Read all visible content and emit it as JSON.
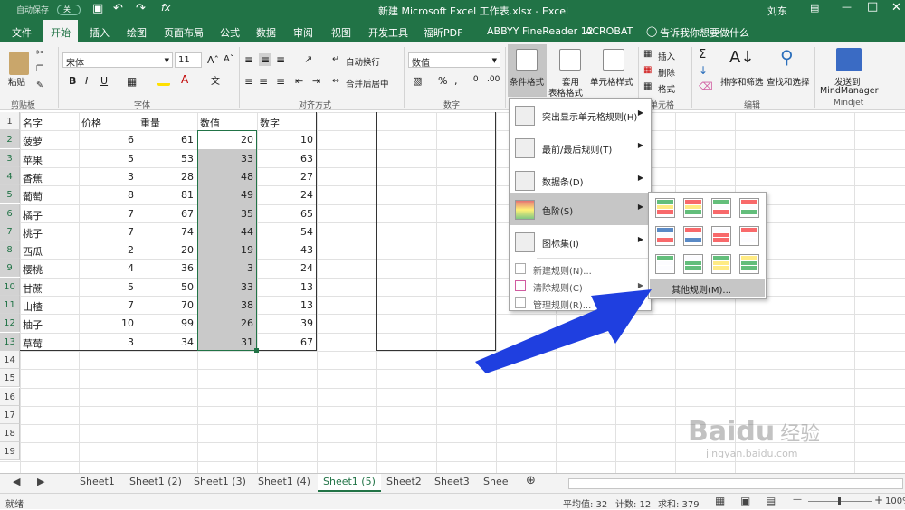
{
  "titlebar": {
    "autosave": "自动保存",
    "autosave_state": "关",
    "title": "新建 Microsoft Excel 工作表.xlsx  -  Excel",
    "user": "刘东"
  },
  "tabs": [
    "文件",
    "开始",
    "插入",
    "绘图",
    "页面布局",
    "公式",
    "数据",
    "审阅",
    "视图",
    "开发工具",
    "福昕PDF",
    "ABBYY FineReader 12",
    "ACROBAT"
  ],
  "tellme": "告诉我你想要做什么",
  "ribbon": {
    "paste": "粘贴",
    "clipboard": "剪贴板",
    "font_name": "宋体",
    "font_size": "11",
    "font_group": "字体",
    "wrap": "自动换行",
    "merge": "合并后居中",
    "align_group": "对齐方式",
    "number_format": "数值",
    "number_group": "数字",
    "cond_format": "条件格式",
    "table_format_1": "套用",
    "table_format_2": "表格格式",
    "cell_style": "单元格样式",
    "insert": "插入",
    "delete": "删除",
    "format": "格式",
    "cells_group": "单元格",
    "sort": "排序和筛选",
    "find": "查找和选择",
    "edit_group": "编辑",
    "send_1": "发送到",
    "send_2": "MindManager",
    "mindjet": "Mindjet",
    "bold": "B",
    "italic": "I",
    "underline": "U",
    "percent": "%"
  },
  "sheet": {
    "headers": [
      "名字",
      "价格",
      "重量",
      "数值",
      "数字"
    ],
    "rows": [
      [
        "菠萝",
        "6",
        "61",
        "20",
        "10"
      ],
      [
        "苹果",
        "5",
        "53",
        "33",
        "63"
      ],
      [
        "香蕉",
        "3",
        "28",
        "48",
        "27"
      ],
      [
        "葡萄",
        "8",
        "81",
        "49",
        "24"
      ],
      [
        "橘子",
        "7",
        "67",
        "35",
        "65"
      ],
      [
        "桃子",
        "7",
        "74",
        "44",
        "54"
      ],
      [
        "西瓜",
        "2",
        "20",
        "19",
        "43"
      ],
      [
        "樱桃",
        "4",
        "36",
        "3",
        "24"
      ],
      [
        "甘蔗",
        "5",
        "50",
        "33",
        "13"
      ],
      [
        "山楂",
        "7",
        "70",
        "38",
        "13"
      ],
      [
        "柚子",
        "10",
        "99",
        "26",
        "39"
      ],
      [
        "草莓",
        "3",
        "34",
        "31",
        "67"
      ]
    ],
    "row_numbers": [
      "1",
      "2",
      "3",
      "4",
      "5",
      "6",
      "7",
      "8",
      "9",
      "10",
      "11",
      "12",
      "13",
      "14",
      "15",
      "16",
      "17",
      "18",
      "19"
    ]
  },
  "cf_menu": [
    {
      "label": "突出显示单元格规则(H)"
    },
    {
      "label": "最前/最后规则(T)"
    },
    {
      "label": "数据条(D)"
    },
    {
      "label": "色阶(S)"
    },
    {
      "label": "图标集(I)"
    }
  ],
  "cf_small": [
    "新建规则(N)...",
    "清除规则(C)",
    "管理规则(R)..."
  ],
  "submenu_more": "其他规则(M)...",
  "sheet_tabs": [
    "Sheet1",
    "Sheet1 (2)",
    "Sheet1 (3)",
    "Sheet1 (4)",
    "Sheet1 (5)",
    "Sheet2",
    "Sheet3",
    "Shee"
  ],
  "status": {
    "mode": "就绪",
    "average": "平均值: 32",
    "count": "计数: 12",
    "sum": "求和: 379",
    "zoom": "100%"
  },
  "watermark": {
    "brand": "Bai",
    "brand2": "du",
    "cn": "经验",
    "url": "jingyan.baidu.com"
  },
  "colors": {
    "accent": "#217346",
    "arrow": "#1f3fe0"
  }
}
